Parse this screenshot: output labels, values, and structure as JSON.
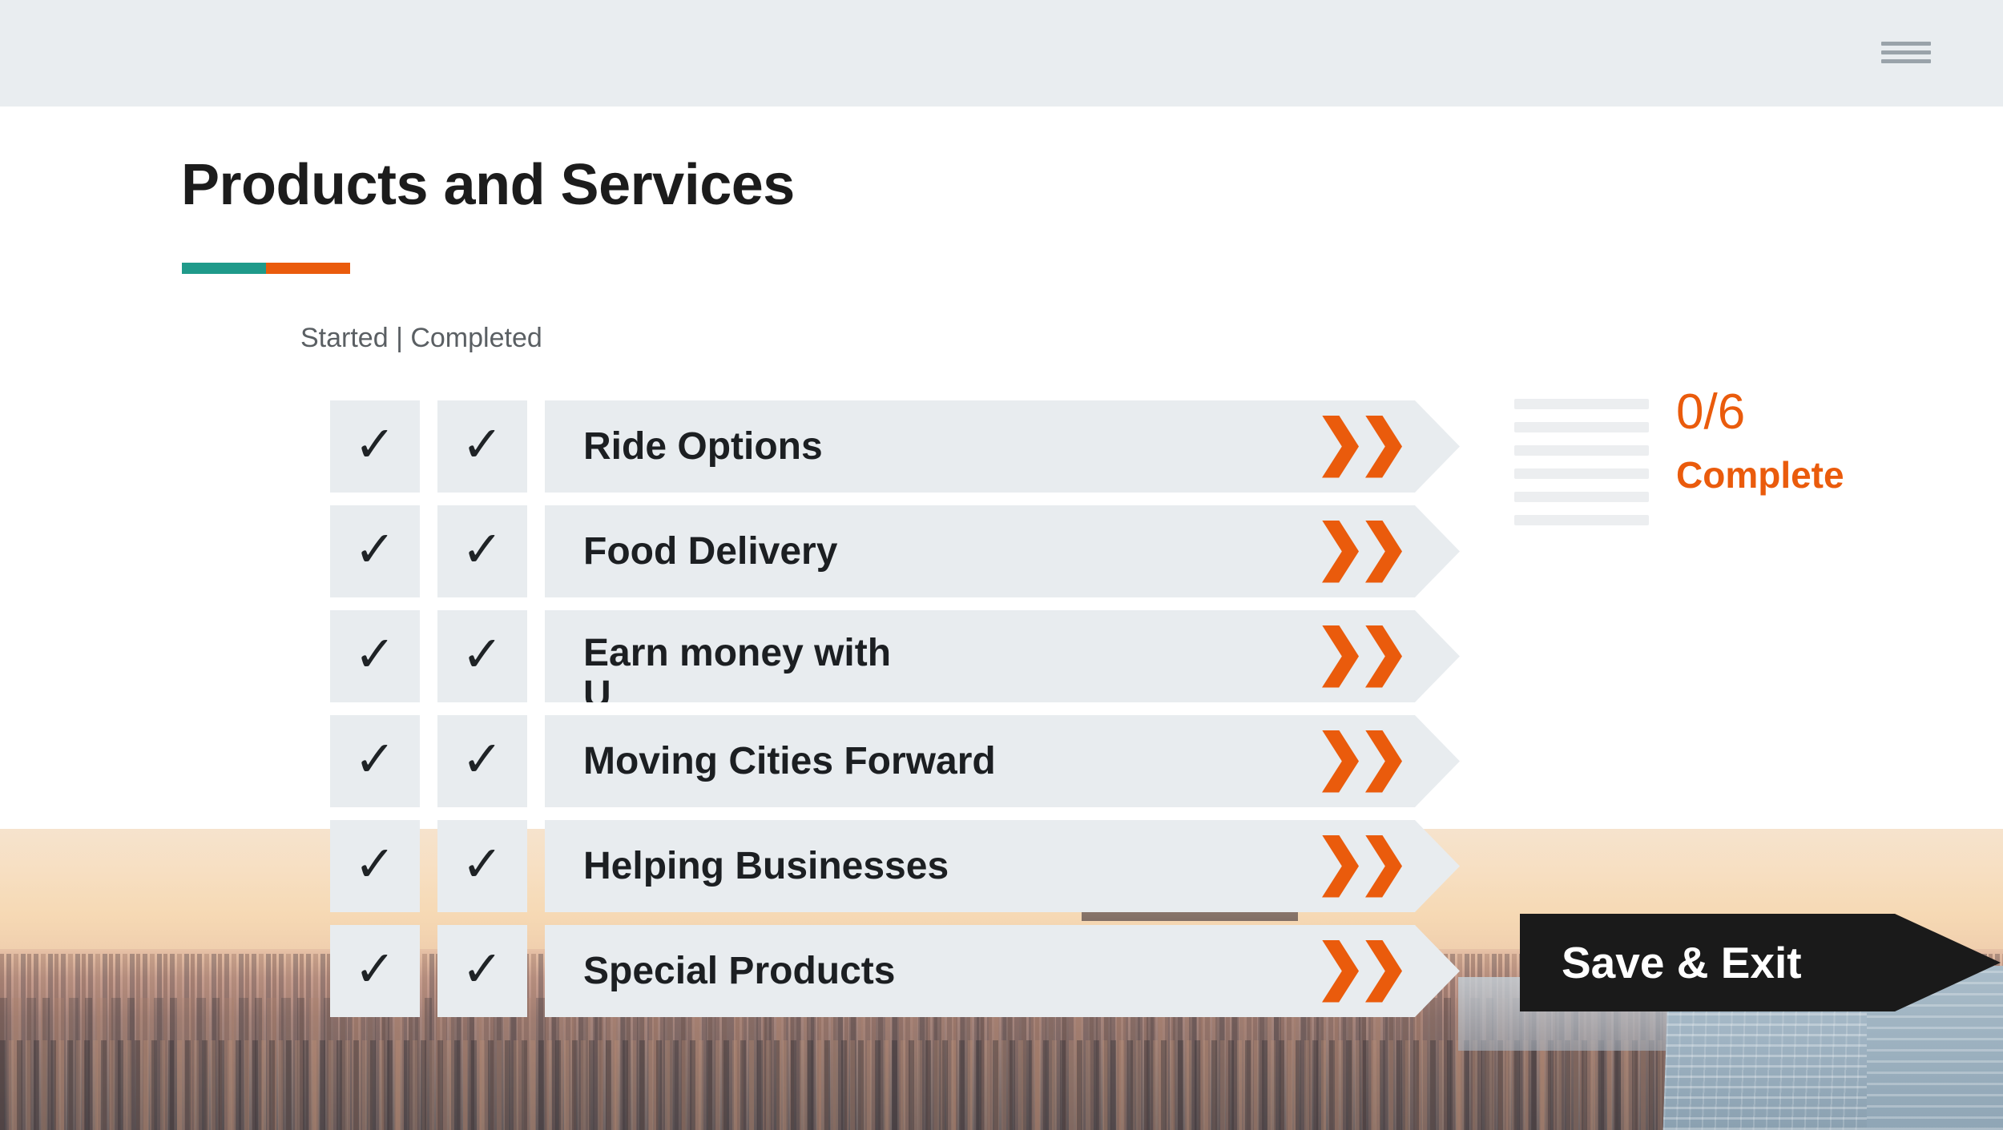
{
  "header": {
    "menu_icon": "hamburger-menu-icon"
  },
  "page": {
    "title": "Products and Services",
    "legend": "Started  |  Completed"
  },
  "checklist": {
    "rows": [
      {
        "label": "Ride Options",
        "started": "✓",
        "completed": "✓",
        "advance_icon": "double-chevron-right-icon"
      },
      {
        "label": "Food Delivery",
        "started": "✓",
        "completed": "✓",
        "advance_icon": "double-chevron-right-icon"
      },
      {
        "label": "Earn money with\nU",
        "started": "✓",
        "completed": "✓",
        "advance_icon": "double-chevron-right-icon"
      },
      {
        "label": "Moving Cities Forward",
        "started": "✓",
        "completed": "✓",
        "advance_icon": "double-chevron-right-icon"
      },
      {
        "label": "Helping Businesses",
        "started": "✓",
        "completed": "✓",
        "advance_icon": "double-chevron-right-icon"
      },
      {
        "label": "Special Products",
        "started": "✓",
        "completed": "✓",
        "advance_icon": "double-chevron-right-icon"
      }
    ]
  },
  "progress": {
    "count": "0/6",
    "word": "Complete",
    "bar_count": 6,
    "filled": 0
  },
  "actions": {
    "save_exit": "Save & Exit"
  },
  "colors": {
    "accent_orange": "#ea5b0c",
    "accent_teal": "#1f9a8a",
    "panel_gray": "#e8ecef",
    "header_gray": "#e9edf0",
    "text_dark": "#1c1f22",
    "button_black": "#1a1a1a"
  }
}
